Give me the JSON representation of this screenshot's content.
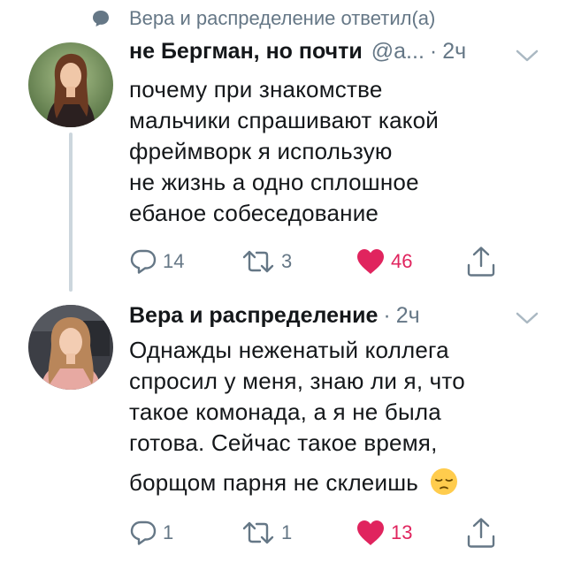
{
  "reply_context": {
    "text": "Вера и распределение ответил(а)"
  },
  "tweets": [
    {
      "author_name": "не Бергман, но почти",
      "handle": "@a...",
      "dot": "·",
      "time": "2ч",
      "lines": [
        "почему при знакомстве",
        "мальчики спрашивают какой",
        "фреймворк я использую",
        "не жизнь а одно сплошное",
        "ебаное собеседование"
      ],
      "replies": "14",
      "retweets": "3",
      "likes": "46"
    },
    {
      "author_name": "Вера и распределение",
      "dot": "·",
      "time": "2ч",
      "lines": [
        "Однажды неженатый коллега",
        "спросил у меня, знаю ли я, что",
        "такое комонада, а я не была",
        "готова. Сейчас такое время,",
        "борщом парня не склеишь"
      ],
      "emoji": "pensive-face",
      "replies": "1",
      "retweets": "1",
      "likes": "13"
    }
  ],
  "colors": {
    "text": "#14171a",
    "secondary": "#657786",
    "like_red": "#e0245e",
    "thread_line": "#ccd6dd"
  },
  "icons": [
    "speech-bubble-icon",
    "reply-icon",
    "retweet-icon",
    "heart-icon",
    "share-icon",
    "chevron-down-icon"
  ]
}
